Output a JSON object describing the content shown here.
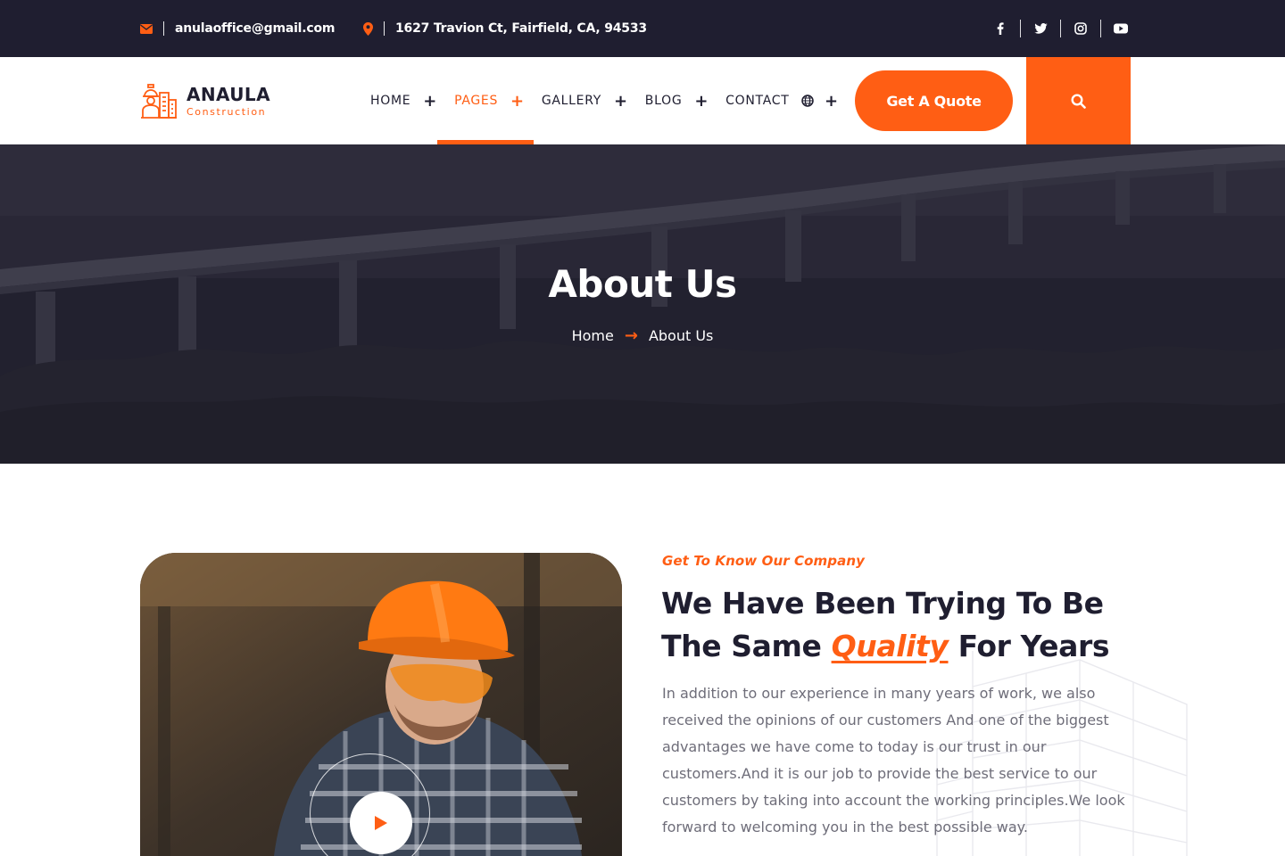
{
  "topbar": {
    "email": "anulaoffice@gmail.com",
    "address": "1627 Travion Ct, Fairfield, CA, 94533",
    "email_icon": "envelope-icon",
    "location_icon": "map-marker-icon",
    "social": [
      "facebook-icon",
      "twitter-icon",
      "instagram-icon",
      "youtube-icon"
    ]
  },
  "header": {
    "logo_name": "ANAULA",
    "logo_sub": "Construction",
    "nav": [
      {
        "label": "HOME",
        "has_sub": true
      },
      {
        "label": "PAGES",
        "has_sub": true,
        "active": true
      },
      {
        "label": "GALLERY",
        "has_sub": true
      },
      {
        "label": "BLOG",
        "has_sub": true
      },
      {
        "label": "CONTACT",
        "has_sub": false
      }
    ],
    "plus": "+",
    "quote_label": "Get A Quote",
    "globe_icon": "globe-icon",
    "search_icon": "search-icon"
  },
  "banner": {
    "title": "About Us",
    "breadcrumb_home": "Home",
    "breadcrumb_arrow": "→",
    "breadcrumb_current": "About Us"
  },
  "about": {
    "kicker": "Get To Know Our Company",
    "heading_line1": "We Have Been Trying To Be",
    "heading_pre": "The Same ",
    "heading_highlight": "Quality",
    "heading_post": " For Years",
    "paragraph": "In addition to our experience in many years of work, we also received the opinions of our customers And one of the biggest advantages we have come to today is our trust in our customers.And it is our job to provide the best service to our customers by taking into account the working principles.We look forward to welcoming you in the best possible way.",
    "play_icon": "play-icon"
  },
  "colors": {
    "accent": "#ff5e14",
    "dark": "#1f1e30",
    "text": "#6e6d79"
  }
}
